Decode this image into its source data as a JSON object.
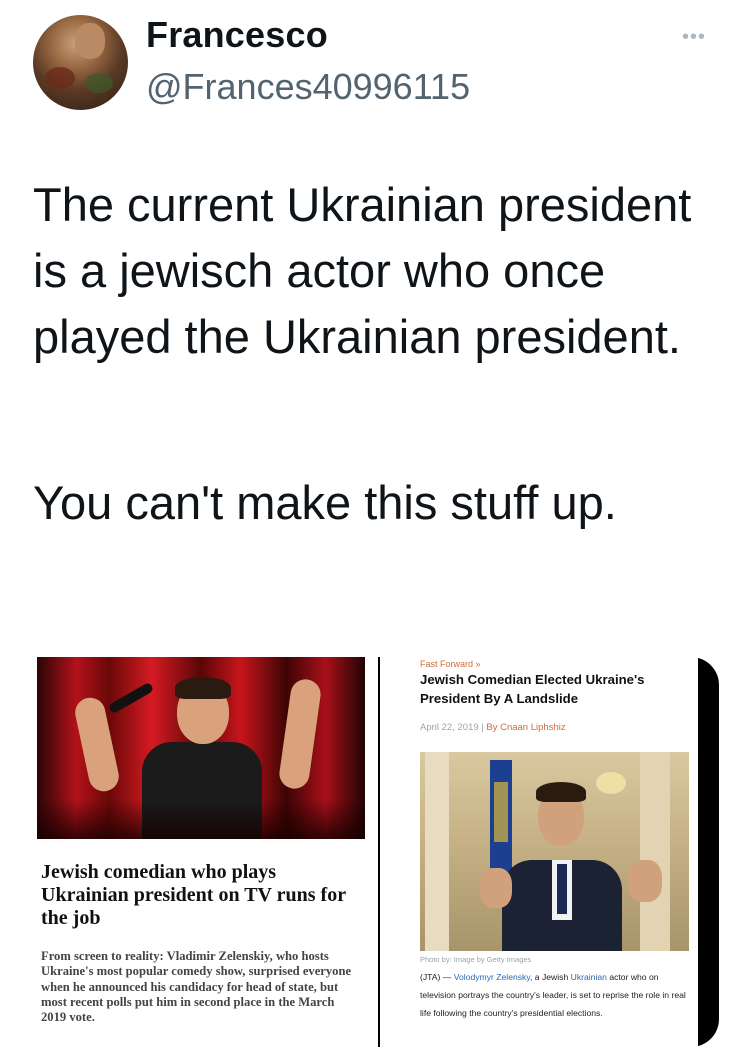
{
  "user": {
    "display_name": "Francesco",
    "handle": "@Frances40996115",
    "more_label": "•••"
  },
  "tweet": {
    "paragraph_1": "The current Ukrainian president is a jewisch actor who once played the Ukrainian president.",
    "paragraph_2": "You can't make this stuff up."
  },
  "left_article": {
    "headline": "Jewish comedian who plays Ukrainian president on TV runs for the job",
    "subheadline": "From screen to reality: Vladimir Zelenskiy, who hosts Ukraine's most popular comedy show, surprised everyone when he announced his candidacy for head of state, but most recent polls put him in second place in the March 2019 vote."
  },
  "right_article": {
    "kicker": "Fast Forward »",
    "headline": "Jewish Comedian Elected Ukraine's President By A Landslide",
    "date": "April 22, 2019",
    "separator": "|",
    "author": "By Cnaan Liphshiz",
    "photo_credit": "Photo by: Image by Getty Images",
    "caption_prefix": "(JTA) —",
    "caption_name": "Volodymyr Zelensky",
    "caption_mid": ", a Jewish",
    "caption_country": "Ukrainian",
    "caption_rest": "actor who on television portrays the country's leader, is set to reprise the role in real life following the country's presidential elections."
  },
  "colors": {
    "handle_gray": "#536471",
    "accent_orange": "#d06a3a",
    "link_blue": "#2b6cb0"
  }
}
